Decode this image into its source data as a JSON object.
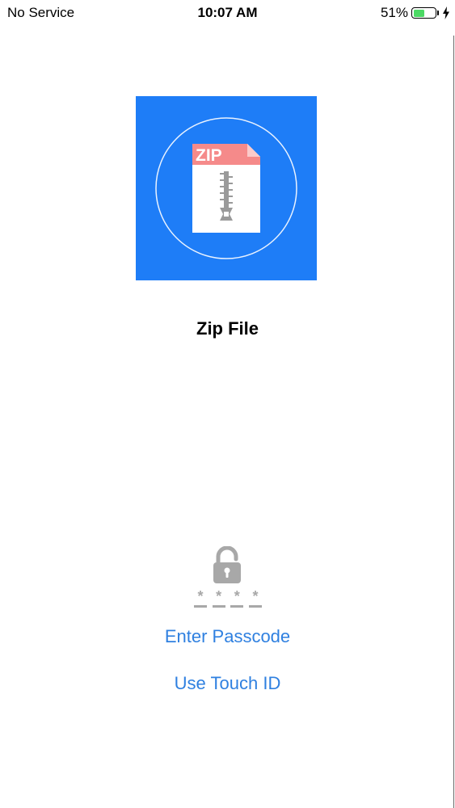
{
  "status_bar": {
    "carrier": "No Service",
    "time": "10:07 AM",
    "battery_percent": "51%",
    "battery_level": 0.51,
    "battery_color": "#4cd964",
    "charging_icon": "bolt-icon"
  },
  "app": {
    "icon_name": "zip-file-icon",
    "icon_label": "ZIP",
    "icon_bg_color": "#1e7df7",
    "name": "Zip File"
  },
  "lock": {
    "icon": "lock-icon",
    "passcode_placeholder": [
      "*",
      "*",
      "*",
      "*"
    ],
    "enter_passcode_label": "Enter Passcode",
    "touch_id_label": "Use Touch ID",
    "link_color": "#2f80e0"
  }
}
